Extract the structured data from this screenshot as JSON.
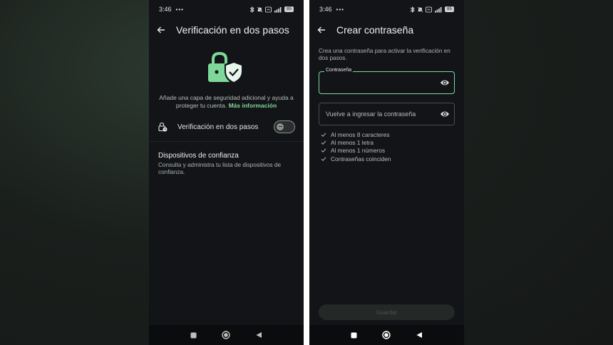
{
  "screens": [
    {
      "status": {
        "time": "3:46",
        "dots": "•••",
        "battery": "85"
      },
      "title": "Verificación en dos pasos",
      "description": "Añade una capa de seguridad adicional y ayuda a proteger tu cuenta.",
      "link": "Más información",
      "toggle_label": "Verificación en dos pasos",
      "toggle_on": false,
      "trusted_title": "Dispositivos de confianza",
      "trusted_description": "Consulta y administra tu lista de dispositivos de confianza."
    },
    {
      "status": {
        "time": "3:46",
        "dots": "•••",
        "battery": "85"
      },
      "title": "Crear contraseña",
      "description": "Crea una contraseña para activar la verificación en dos pasos.",
      "password_label": "Contraseña",
      "password_value": "",
      "confirm_placeholder": "Vuelve a ingresar la contraseña",
      "requirements": [
        "Al menos 8 caracteres",
        "Al menos 1 letra",
        "Al menos 1 números",
        "Contraseñas coinciden"
      ],
      "save_label": "Guardar"
    }
  ],
  "colors": {
    "accent": "#7ed89a",
    "background": "#121417",
    "text": "#e3e6e4"
  },
  "icons": {
    "back": "arrow-left-icon",
    "hero": "lock-shield-icon",
    "eye": "eye-icon",
    "check": "check-icon"
  }
}
